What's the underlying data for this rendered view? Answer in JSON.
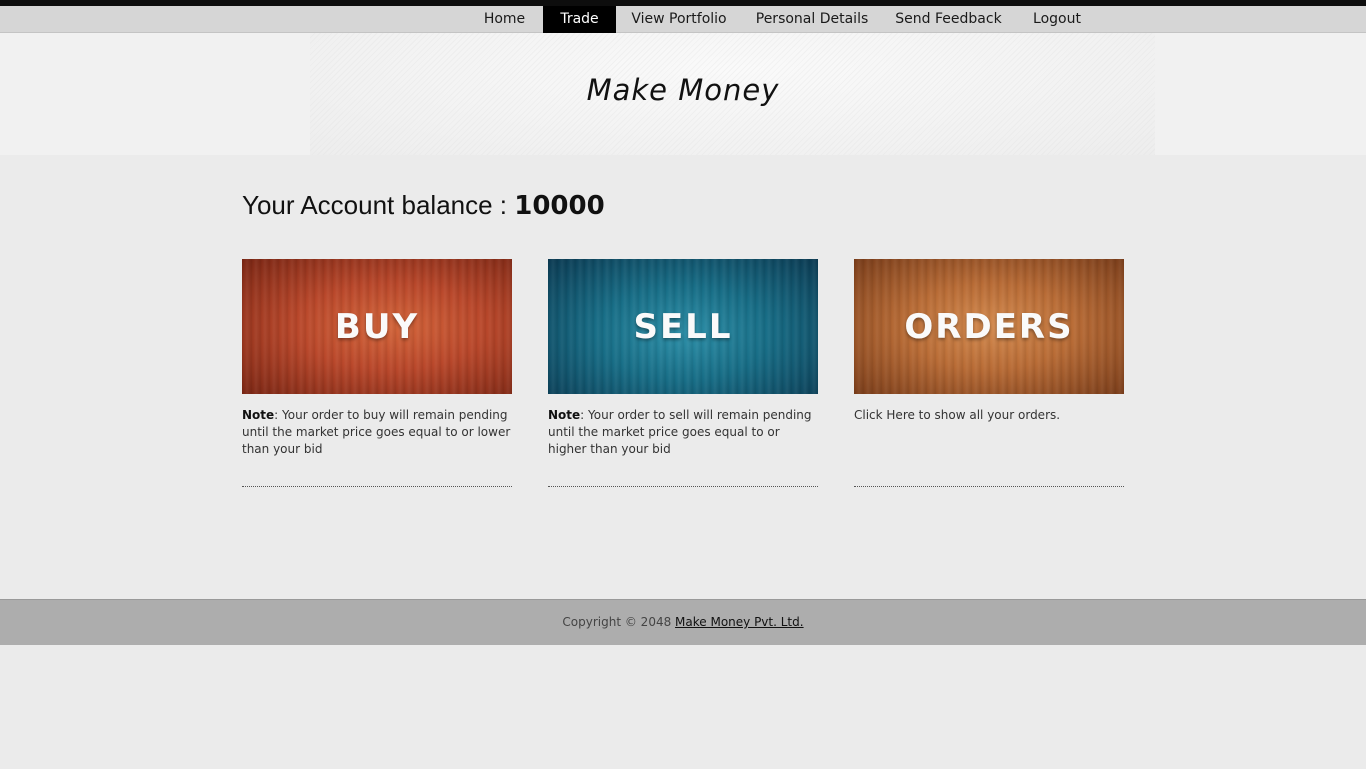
{
  "nav": {
    "items": [
      {
        "label": "Home"
      },
      {
        "label": "Trade",
        "active": true
      },
      {
        "label": "View Portfolio"
      },
      {
        "label": "Personal Details"
      },
      {
        "label": "Send Feedback"
      },
      {
        "label": "Logout"
      }
    ]
  },
  "header": {
    "title": "Make Money"
  },
  "balance": {
    "label": "Your Account balance : ",
    "value": "10000"
  },
  "cards": [
    {
      "banner": "BUY",
      "note_prefix": "Note",
      "note_text": ": Your order to buy will remain pending until the market price goes equal to or lower than your bid"
    },
    {
      "banner": "SELL",
      "note_prefix": "Note",
      "note_text": ": Your order to sell will remain pending until the market price goes equal to or higher than your bid"
    },
    {
      "banner": "ORDERS",
      "note_prefix": "",
      "note_text": "Click Here to show all your orders."
    }
  ],
  "footer": {
    "copyright": "Copyright © 2048 ",
    "company": "Make Money Pvt. Ltd."
  },
  "colors": {
    "nav_active_bg": "#000000",
    "buy_banner": "#b9472a",
    "sell_banner": "#176d86",
    "orders_banner": "#b86b35",
    "footer_bg": "#adadad"
  }
}
